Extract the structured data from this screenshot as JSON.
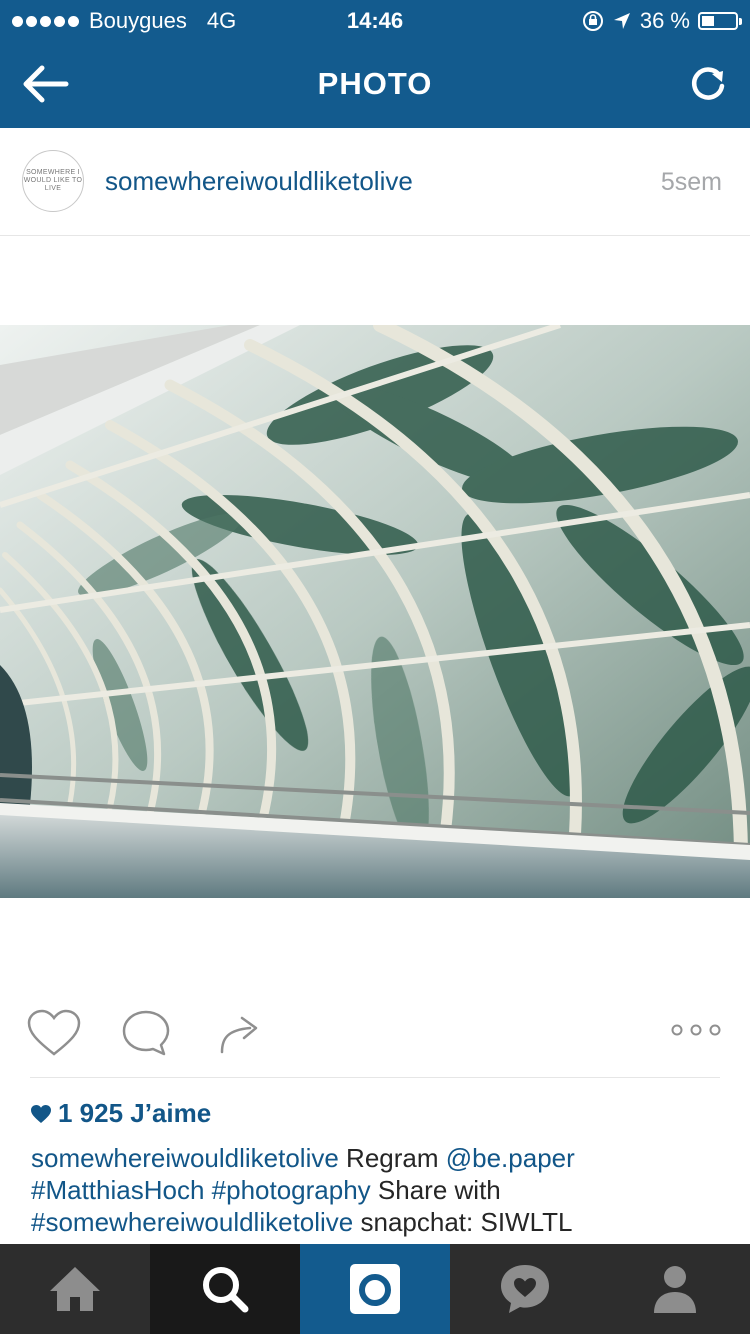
{
  "status_bar": {
    "carrier": "Bouygues",
    "network": "4G",
    "time": "14:46",
    "battery": "36 %",
    "battery_level": 0.36
  },
  "nav": {
    "title": "PHOTO",
    "back_icon": "back-arrow-icon",
    "refresh_icon": "refresh-icon"
  },
  "post": {
    "username": "somewhereiwouldliketolive",
    "avatar_text": "SOMEWHERE I WOULD LIKE TO LIVE",
    "age": "5sem",
    "likes": "1 925 J’aime",
    "caption": {
      "username": "somewhereiwouldliketolive",
      "text1": " Regram ",
      "mention": "@be.paper",
      "space": " ",
      "tag1": "#MatthiasHoch",
      "tag2": "#photography",
      "text2": " Share with ",
      "tag3": "#somewhereiwouldliketolive",
      "text3": " snapchat: SIWLTL"
    }
  },
  "actions": {
    "like_icon": "heart-outline-icon",
    "comment_icon": "comment-bubble-icon",
    "share_icon": "share-arrow-icon",
    "more_icon": "more-dots-icon"
  },
  "tabbar": {
    "items": [
      "home-icon",
      "search-icon",
      "camera-icon",
      "activity-heart-icon",
      "profile-icon"
    ],
    "active_index": 2
  },
  "colors": {
    "accent": "#135b8e",
    "link": "#125688",
    "tabbar": "#2d2d2d"
  }
}
